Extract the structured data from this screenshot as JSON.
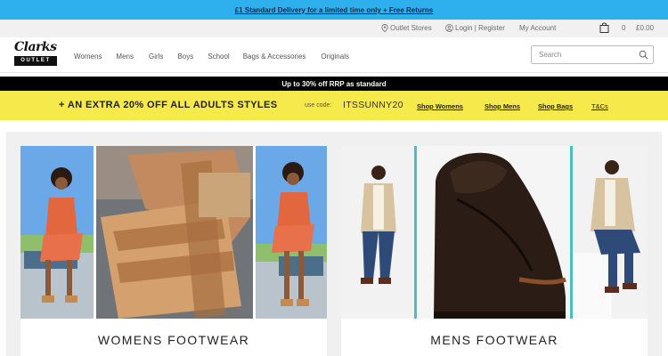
{
  "promo": {
    "text": "£1 Standard Delivery for a limited time only + Free Returns"
  },
  "utility": {
    "stores": "Outlet Stores",
    "login": "Login | Register",
    "account": "My Account",
    "bag_count": "0",
    "bag_total": "£0.00"
  },
  "header": {
    "logo_script": "Clarks",
    "logo_sub": "OUTLET",
    "nav": [
      "Womens",
      "Mens",
      "Girls",
      "Boys",
      "School",
      "Bags & Accessories",
      "Originals"
    ],
    "search_placeholder": "Search"
  },
  "sale_strip": {
    "text": "Up to 30% off RRP as standard"
  },
  "banner": {
    "headline": "+ AN EXTRA 20% OFF  ALL ADULTS STYLES",
    "use_code_label": "use code:",
    "code": "ITSSUNNY20",
    "links": [
      "Shop Womens",
      "Shop Mens",
      "Shop Bags",
      "T&Cs"
    ]
  },
  "cards": [
    {
      "title": "WOMENS FOOTWEAR",
      "image_alt": "Model in orange dress beside tan wedge sandal"
    },
    {
      "title": "MENS FOOTWEAR",
      "image_alt": "Model in beige jacket beside dark brown boat shoe"
    }
  ],
  "colors": {
    "promo_bg": "#2fb0ee",
    "banner_bg": "#f6e94b",
    "strip_bg": "#000000",
    "content_bg": "#f0f0f0"
  }
}
